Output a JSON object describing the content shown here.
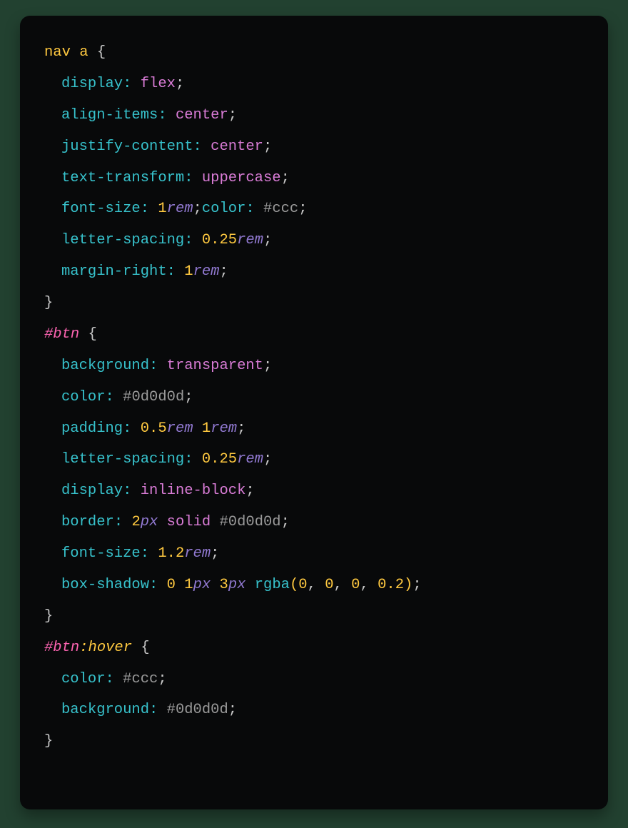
{
  "code": {
    "rule1": {
      "selector_tag": "nav",
      "selector_el": "a",
      "display_prop": "display",
      "display_val": "flex",
      "align_prop": "align-items",
      "align_val": "center",
      "justify_prop": "justify-content",
      "justify_val": "center",
      "tt_prop": "text-transform",
      "tt_val": "uppercase",
      "fs_prop": "font-size",
      "fs_num": "1",
      "fs_unit": "rem",
      "color_prop": "color",
      "color_val": "#ccc",
      "ls_prop": "letter-spacing",
      "ls_num": "0.25",
      "ls_unit": "rem",
      "mr_prop": "margin-right",
      "mr_num": "1",
      "mr_unit": "rem"
    },
    "rule2": {
      "selector": "#btn",
      "bg_prop": "background",
      "bg_val": "transparent",
      "color_prop": "color",
      "color_val": "#0d0d0d",
      "pad_prop": "padding",
      "pad_num1": "0.5",
      "pad_unit1": "rem",
      "pad_num2": "1",
      "pad_unit2": "rem",
      "ls_prop": "letter-spacing",
      "ls_num": "0.25",
      "ls_unit": "rem",
      "disp_prop": "display",
      "disp_val": "inline-block",
      "bd_prop": "border",
      "bd_num": "2",
      "bd_unit": "px",
      "bd_style": "solid",
      "bd_color": "#0d0d0d",
      "fs_prop": "font-size",
      "fs_num": "1.2",
      "fs_unit": "rem",
      "bs_prop": "box-shadow",
      "bs_v0": "0",
      "bs_v1_num": "1",
      "bs_v1_unit": "px",
      "bs_v2_num": "3",
      "bs_v2_unit": "px",
      "bs_fn": "rgba",
      "bs_a0": "0",
      "bs_a1": "0",
      "bs_a2": "0",
      "bs_a3": "0.2"
    },
    "rule3": {
      "selector": "#btn",
      "pseudo": ":hover",
      "color_prop": "color",
      "color_val": "#ccc",
      "bg_prop": "background",
      "bg_val": "#0d0d0d"
    },
    "sp": " ",
    "open": "{",
    "close": "}",
    "colon": ":",
    "semi": ";",
    "lparen": "(",
    "rparen": ")",
    "comma": ","
  }
}
